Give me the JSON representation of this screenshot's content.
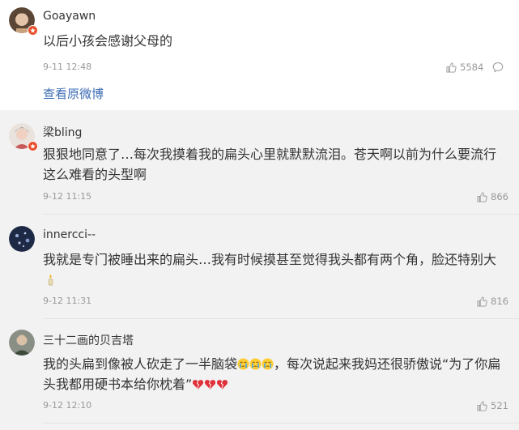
{
  "top_comment": {
    "username": "Goayawn",
    "text": "以后小孩会感谢父母的",
    "time": "9-11 12:48",
    "likes": "5584",
    "view_original": "查看原微博"
  },
  "comments": [
    {
      "username": "梁bling",
      "text": "狠狠地同意了…每次我摸着我的扁头心里就默默流泪。苍天啊以前为什么要流行这么难看的头型啊",
      "time": "9-12 11:15",
      "likes": "866"
    },
    {
      "username": "innercci--",
      "text": "我就是专门被睡出来的扁头…我有时候摸甚至觉得我头都有两个角，脸还特别大",
      "time": "9-12 11:31",
      "likes": "816"
    },
    {
      "username": "三十二画的贝吉塔",
      "text_part1": "我的头扁到像被人砍走了一半脑袋",
      "text_part2": "，每次说起来我妈还很骄傲说“为了你扁头我都用硬书本给你枕着”",
      "time": "9-12 12:10",
      "likes": "521"
    }
  ],
  "icons": {
    "like": "thumbs-up-icon",
    "reply": "speech-bubble-icon",
    "verified": "verified-badge-icon",
    "cry_emoji": "crying-face-emoji",
    "heart_emoji": "broken-heart-emoji",
    "candle_emoji": "candle-emoji"
  },
  "colors": {
    "link": "#3d6db4",
    "badge": "#e8502d",
    "muted": "#999999",
    "text": "#333333"
  }
}
